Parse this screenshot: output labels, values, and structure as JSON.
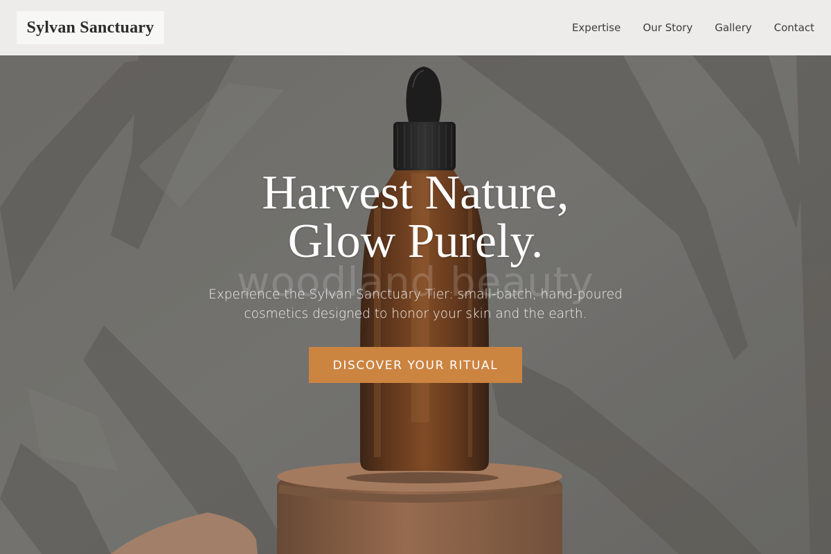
{
  "header": {
    "logo_text": "Sylvan Sanctuary",
    "nav_items": [
      "Expertise",
      "Our Story",
      "Gallery",
      "Contact"
    ]
  },
  "hero": {
    "headline_line1": "Harvest Nature,",
    "headline_line2": "Glow Purely.",
    "watermark_text": "woodland beauty",
    "subtext": "Experience the Sylvan Sanctuary Tier: small-batch, hand-poured cosmetics designed to honor your skin and the earth.",
    "cta_label": "DISCOVER YOUR RITUAL",
    "background_image": "amber-dropper-bottle-on-wooden-pedestal-with-leaf-shadows"
  },
  "colors": {
    "header_bg": "#f2f1ef",
    "accent": "#cc8441",
    "text_dark": "#2b2b2b"
  }
}
